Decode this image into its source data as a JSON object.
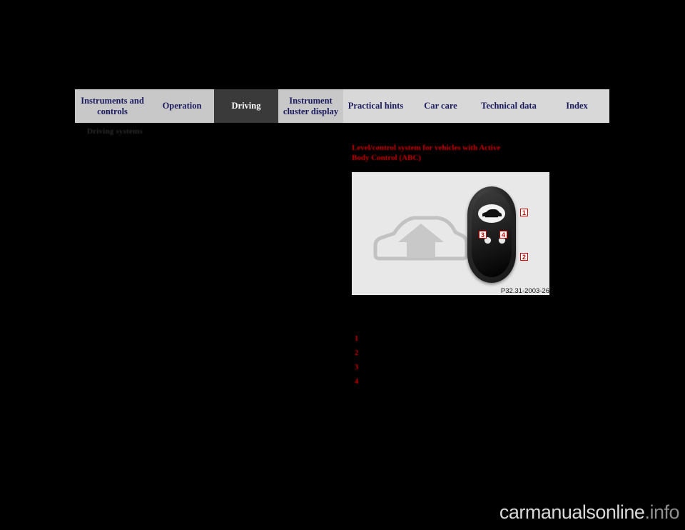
{
  "tabs": [
    {
      "label": "Instruments and controls",
      "style": "light"
    },
    {
      "label": "Operation",
      "style": "light"
    },
    {
      "label": "Driving",
      "style": "dark"
    },
    {
      "label": "Instrument cluster display",
      "style": "light"
    },
    {
      "label": "Practical hints",
      "style": "light2"
    },
    {
      "label": "Car care",
      "style": "light2"
    },
    {
      "label": "Technical data",
      "style": "light2"
    },
    {
      "label": "Index",
      "style": "light2"
    }
  ],
  "left": {
    "section_label": "Driving systems"
  },
  "right": {
    "figure_heading": "Level/control system for vehicles with Active Body Control (ABC)",
    "figure_caption": "P32.31-2003-26",
    "callouts": {
      "one": "1",
      "two": "2",
      "three": "3",
      "four": "4"
    },
    "legend": [
      {
        "number": "1",
        "text": ""
      },
      {
        "number": "2",
        "text": ""
      },
      {
        "number": "3",
        "text": ""
      },
      {
        "number": "4",
        "text": ""
      }
    ]
  },
  "watermark": {
    "brand": "carmanuals",
    "suffix": "online",
    "tld": ".info"
  },
  "colors": {
    "accent_red": "#cc0000",
    "tab_navy": "#1a1a5e",
    "tab_light": "#c8c8c8",
    "tab_dark": "#3a3a3a",
    "figure_bg": "#e8e8e8",
    "page_bg": "#000000"
  }
}
